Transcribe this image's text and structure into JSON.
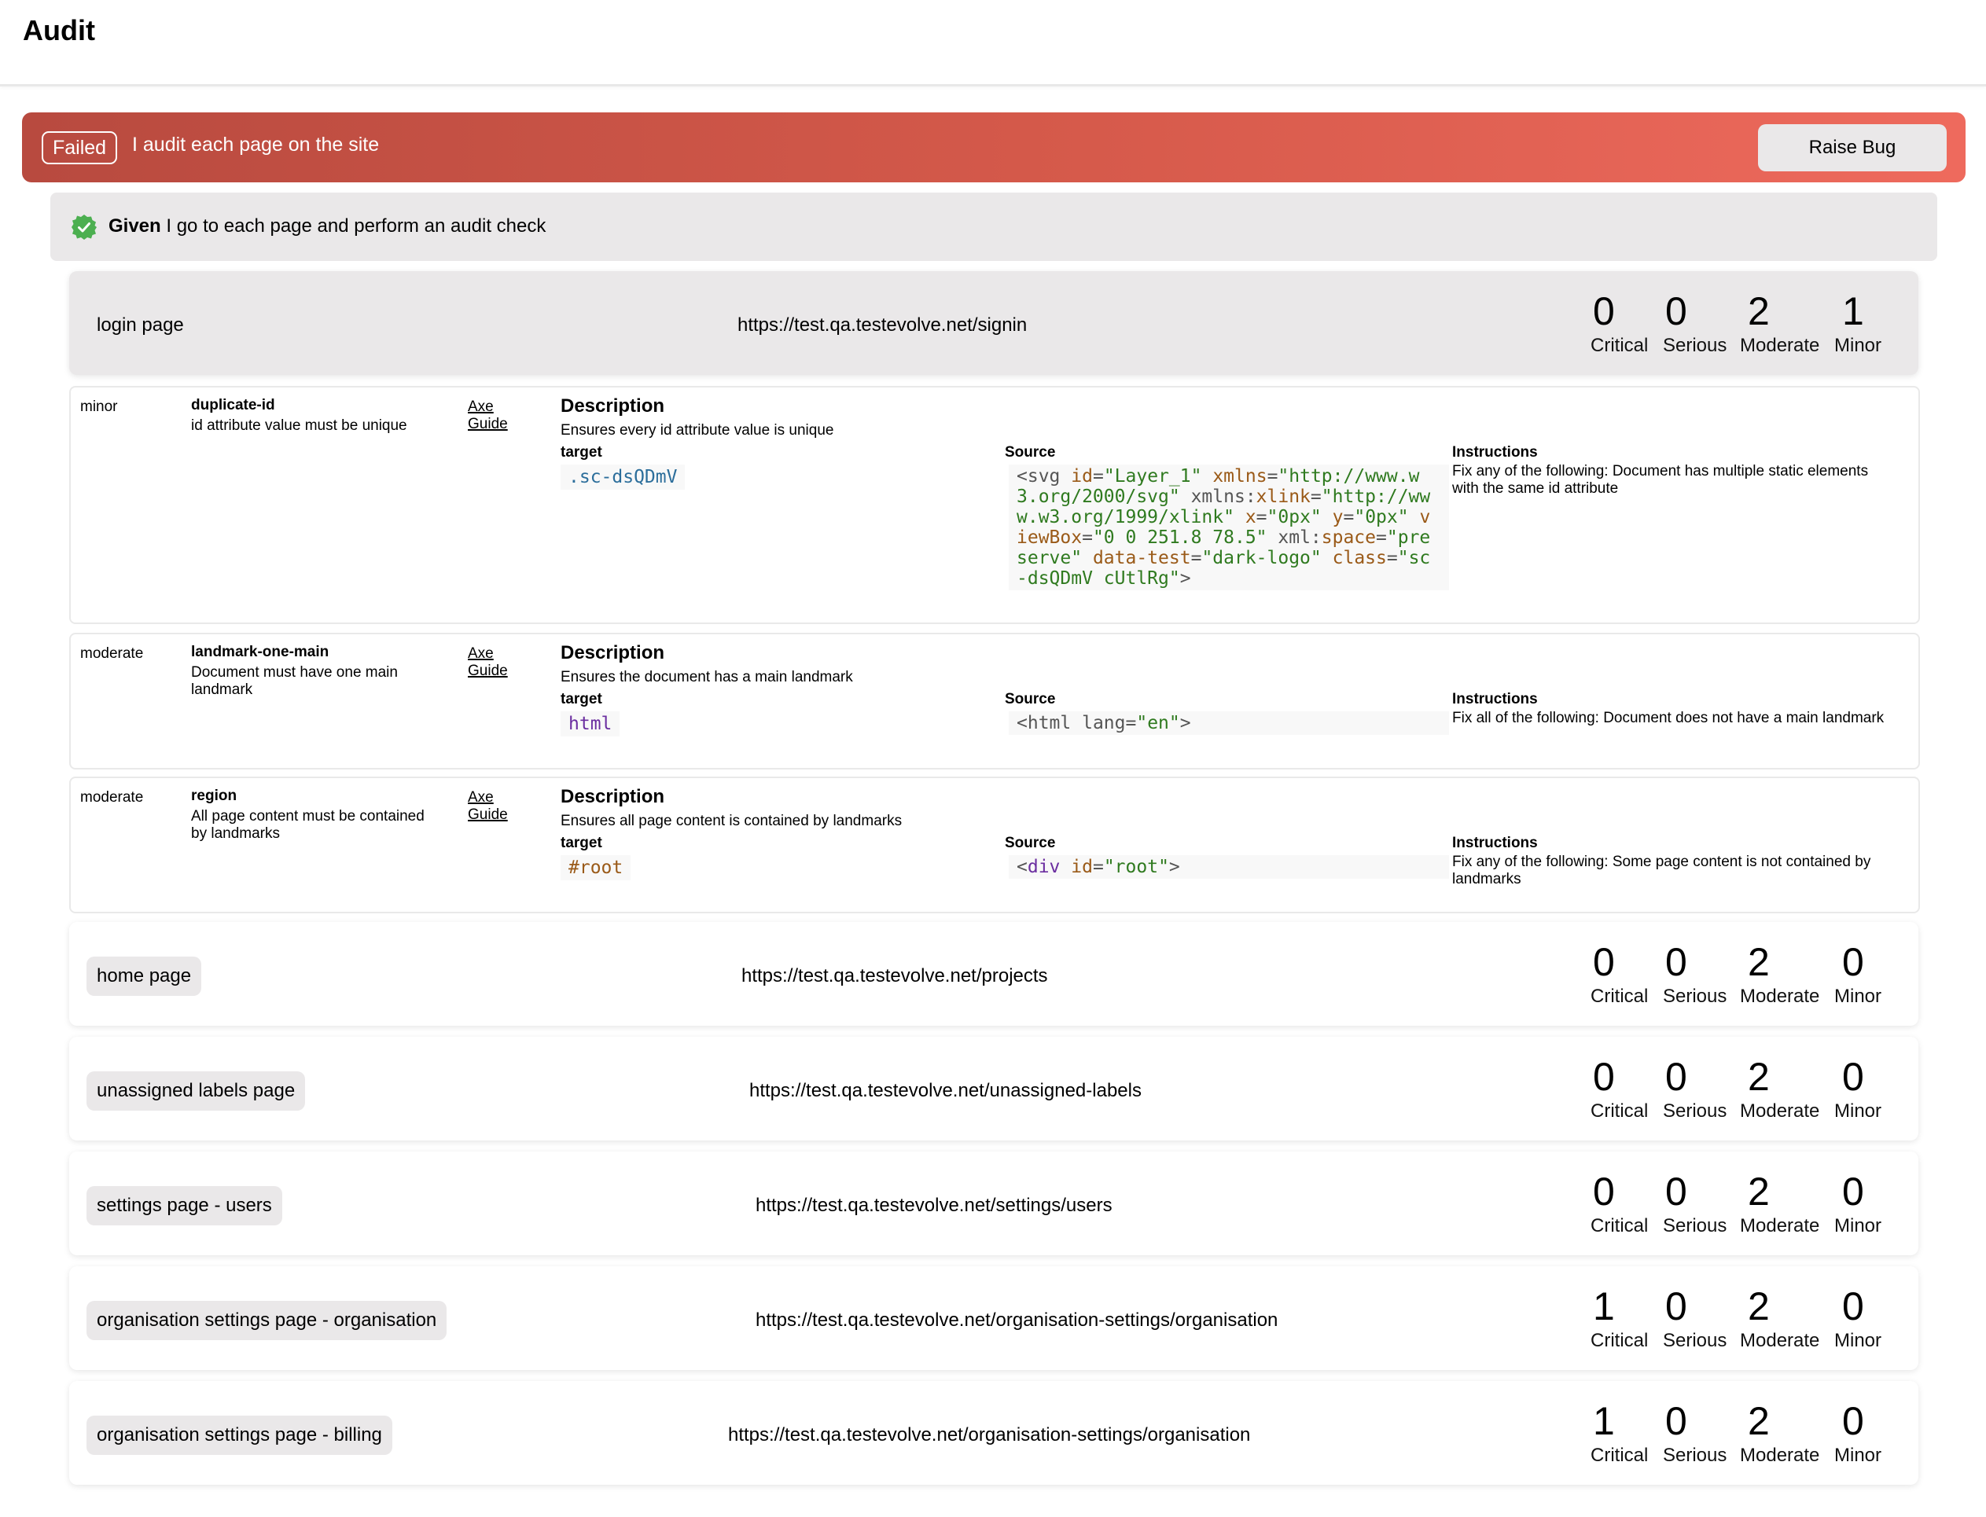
{
  "header": {
    "title": "Audit"
  },
  "scenario": {
    "status": "Failed",
    "title": "I audit each page on the site",
    "raise_bug_label": "Raise Bug",
    "colors": {
      "banner_start": "#b84a3f",
      "banner_end": "#ee6a5d",
      "pass_green": "#4caf50"
    }
  },
  "step": {
    "keyword": "Given",
    "text": "I go to each page and perform an audit check",
    "status_icon": "check-badge-icon"
  },
  "count_labels": [
    "Critical",
    "Serious",
    "Moderate",
    "Minor"
  ],
  "pages": [
    {
      "name": "login page",
      "url": "https://test.qa.testevolve.net/signin",
      "counts": [
        "0",
        "0",
        "2",
        "1"
      ],
      "expanded": true
    },
    {
      "name": "home page",
      "url": "https://test.qa.testevolve.net/projects",
      "counts": [
        "0",
        "0",
        "2",
        "0"
      ]
    },
    {
      "name": "unassigned labels page",
      "url": "https://test.qa.testevolve.net/unassigned-labels",
      "counts": [
        "0",
        "0",
        "2",
        "0"
      ]
    },
    {
      "name": "settings page - users",
      "url": "https://test.qa.testevolve.net/settings/users",
      "counts": [
        "0",
        "0",
        "2",
        "0"
      ]
    },
    {
      "name": "organisation settings page - organisation",
      "url": "https://test.qa.testevolve.net/organisation-settings/organisation",
      "counts": [
        "1",
        "0",
        "2",
        "0"
      ]
    },
    {
      "name": "organisation settings page - billing",
      "url": "https://test.qa.testevolve.net/organisation-settings/organisation",
      "counts": [
        "1",
        "0",
        "2",
        "0"
      ]
    }
  ],
  "violation_labels": {
    "description": "Description",
    "target": "target",
    "source": "Source",
    "instructions": "Instructions",
    "guide_link": "Axe Guide"
  },
  "violations": [
    {
      "impact": "minor",
      "rule": "duplicate-id",
      "help": "id attribute value must be unique",
      "description": "Ensures every id attribute value is unique",
      "target": ".sc-dsQDmV",
      "source": "<svg id=\"Layer_1\" xmlns=\"http://www.w3.org/2000/svg\" xmlns:xlink=\"http://www.w3.org/1999/xlink\" x=\"0px\" y=\"0px\" viewBox=\"0 0 251.8 78.5\" xml:space=\"preserve\" data-test=\"dark-logo\" class=\"sc-dsQDmV cUtlRg\">",
      "instructions": "Fix any of the following: Document has multiple static elements with the same id attribute"
    },
    {
      "impact": "moderate",
      "rule": "landmark-one-main",
      "help": "Document must have one main landmark",
      "description": "Ensures the document has a main landmark",
      "target": "html",
      "source": "<html lang=\"en\">",
      "instructions": "Fix all of the following: Document does not have a main landmark"
    },
    {
      "impact": "moderate",
      "rule": "region",
      "help": "All page content must be contained by landmarks",
      "description": "Ensures all page content is contained by landmarks",
      "target": "#root",
      "source": "<div id=\"root\">",
      "instructions": "Fix any of the following: Some page content is not contained by landmarks"
    }
  ]
}
